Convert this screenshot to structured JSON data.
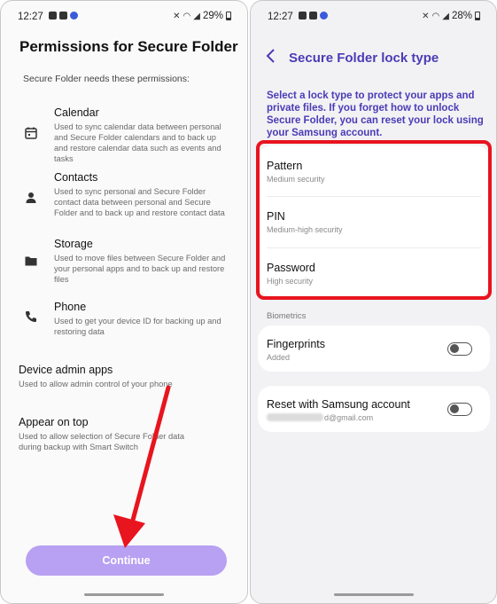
{
  "left": {
    "status": {
      "time": "12:27",
      "battery": "29%"
    },
    "title": "Permissions for Secure Folder",
    "subtitle": "Secure Folder needs these permissions:",
    "permissions": [
      {
        "label": "Calendar",
        "icon": "calendar-icon",
        "desc": "Used to sync calendar data between personal and Secure Folder calendars and to back up and restore calendar data such as events and tasks"
      },
      {
        "label": "Contacts",
        "icon": "person-icon",
        "desc": "Used to sync personal and Secure Folder contact data between personal and Secure Folder and to back up and restore contact data"
      },
      {
        "label": "Storage",
        "icon": "folder-icon",
        "desc": "Used to move files between Secure Folder and your personal apps and to back up and restore files"
      },
      {
        "label": "Phone",
        "icon": "phone-icon",
        "desc": "Used to get your device ID for backing up and restoring data"
      }
    ],
    "extras": [
      {
        "label": "Device admin apps",
        "desc": "Used to allow admin control of your phone"
      },
      {
        "label": "Appear on top",
        "desc": "Used to allow selection of Secure Folder data during backup with Smart Switch"
      }
    ],
    "continue_label": "Continue",
    "accent": "#b8a0f2"
  },
  "right": {
    "status": {
      "time": "12:27",
      "battery": "28%"
    },
    "title": "Secure Folder lock type",
    "description": "Select a lock type to protect your apps and private files. If you forget how to unlock Secure Folder, you can reset your lock using your Samsung account.",
    "lock_options": [
      {
        "label": "Pattern",
        "sub": "Medium security"
      },
      {
        "label": "PIN",
        "sub": "Medium-high security"
      },
      {
        "label": "Password",
        "sub": "High security"
      }
    ],
    "biometrics_label": "Biometrics",
    "fingerprints": {
      "label": "Fingerprints",
      "sub": "Added",
      "on": false
    },
    "reset": {
      "label": "Reset with Samsung account",
      "email_suffix": "d@gmail.com",
      "on": false
    },
    "accent": "#4b3bb6",
    "highlight": "#e8141e"
  }
}
